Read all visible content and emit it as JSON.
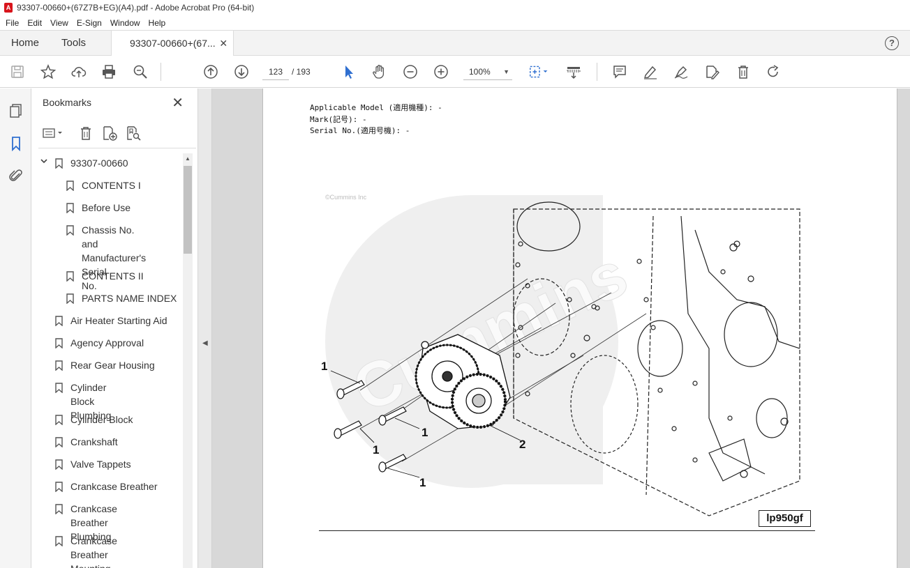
{
  "window": {
    "title": "93307-00660+(67Z7B+EG)(A4).pdf - Adobe Acrobat Pro (64-bit)"
  },
  "menu": [
    "File",
    "Edit",
    "View",
    "E-Sign",
    "Window",
    "Help"
  ],
  "tabs": {
    "home": "Home",
    "tools": "Tools",
    "document": "93307-00660+(67...",
    "help": "?"
  },
  "toolbar": {
    "page_current": "123",
    "page_total": "/ 193",
    "zoom": "100%"
  },
  "bookmarks": {
    "title": "Bookmarks",
    "items": [
      {
        "label": "93307-00660",
        "level": 0,
        "expanded": true
      },
      {
        "label": "CONTENTS I",
        "level": 1
      },
      {
        "label": "Before Use",
        "level": 1
      },
      {
        "label": "Chassis No. and\nManufacturer's Serial\nNo.",
        "level": 1
      },
      {
        "label": "CONTENTS II",
        "level": 1
      },
      {
        "label": "PARTS NAME INDEX",
        "level": 1
      },
      {
        "label": "Air Heater Starting Aid",
        "level": 0
      },
      {
        "label": "Agency Approval",
        "level": 0
      },
      {
        "label": "Rear Gear Housing",
        "level": 0
      },
      {
        "label": "Cylinder Block\nPlumbing",
        "level": 0
      },
      {
        "label": "Cylinder Block",
        "level": 0
      },
      {
        "label": "Crankshaft",
        "level": 0
      },
      {
        "label": "Valve Tappets",
        "level": 0
      },
      {
        "label": "Crankcase Breather",
        "level": 0
      },
      {
        "label": "Crankcase Breather\nPlumbing",
        "level": 0
      },
      {
        "label": "Crankcase Breather\nMounting",
        "level": 0
      }
    ]
  },
  "document": {
    "applicable_model": "Applicable Model (適用機種): -",
    "mark": "Mark(記号): -",
    "serial_no": "Serial No.(適用号機): -",
    "copyright": "©Cummins Inc",
    "figure_label": "lp950gf",
    "callouts": [
      "1",
      "1",
      "1",
      "1",
      "2"
    ]
  },
  "colors": {
    "accent_blue": "#2f6fd0",
    "pdf_red": "#d8141b"
  }
}
